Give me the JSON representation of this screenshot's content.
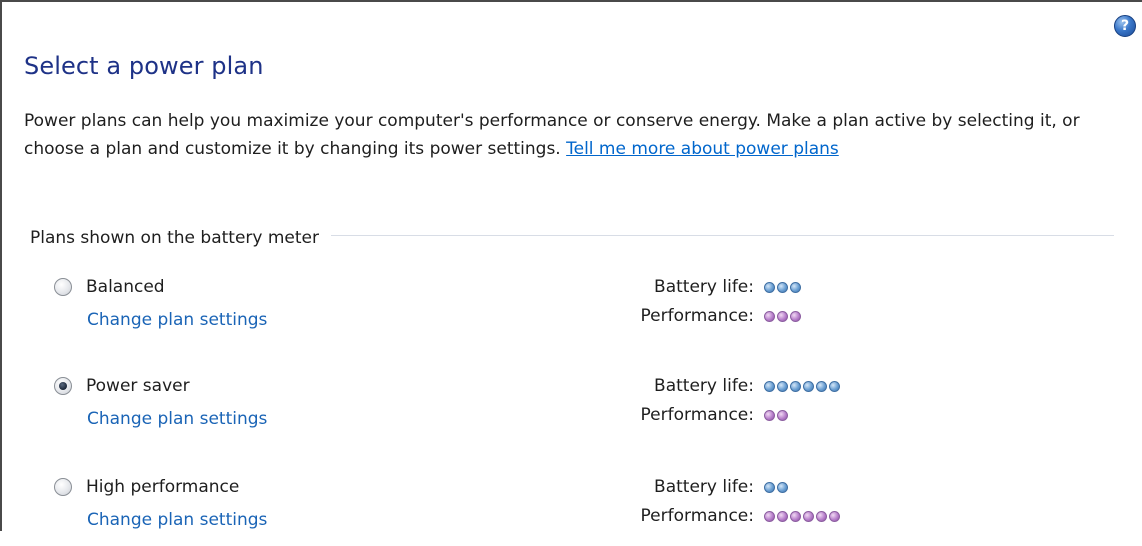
{
  "help": {
    "icon": "help-icon",
    "glyph": "?"
  },
  "header": {
    "title": "Select a power plan"
  },
  "description": {
    "text": "Power plans can help you maximize your computer's performance or conserve energy. Make a plan active by selecting it, or choose a plan and customize it by changing its power settings. ",
    "link_text": "Tell me more about power plans"
  },
  "group": {
    "label": "Plans shown on the battery meter"
  },
  "labels": {
    "battery": "Battery life:",
    "performance": "Performance:"
  },
  "plans": [
    {
      "name": "Balanced",
      "selected": false,
      "link": "Change plan settings",
      "battery_dots": 3,
      "performance_dots": 3
    },
    {
      "name": "Power saver",
      "selected": true,
      "link": "Change plan settings",
      "battery_dots": 6,
      "performance_dots": 2
    },
    {
      "name": "High performance",
      "selected": false,
      "link": "Change plan settings",
      "battery_dots": 2,
      "performance_dots": 6
    }
  ],
  "colors": {
    "title": "#1e3287",
    "link": "#1a64b6",
    "battery_dot": "#6a9fd3",
    "performance_dot": "#b77fcb"
  }
}
